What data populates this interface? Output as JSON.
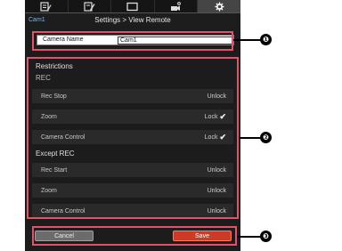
{
  "tabs": [
    {
      "icon": "edit-list-icon",
      "active": false
    },
    {
      "icon": "edit-pencil-icon",
      "active": false
    },
    {
      "icon": "view-screen-icon",
      "active": false
    },
    {
      "icon": "camera-settings-icon",
      "active": false
    },
    {
      "icon": "gear-icon",
      "active": true
    }
  ],
  "header": {
    "camera_label": "Cam1",
    "title": "Settings > View Remote"
  },
  "camera_name": {
    "label": "Camera Name",
    "value": "Cam1"
  },
  "restrictions": {
    "title": "Restrictions",
    "rec_title": "REC",
    "rec_rows": [
      {
        "label": "Rec Stop",
        "value": "Unlock",
        "checked": false
      },
      {
        "label": "Zoom",
        "value": "Lock",
        "checked": true
      },
      {
        "label": "Camera Control",
        "value": "Lock",
        "checked": true
      }
    ],
    "except_title": "Except REC",
    "except_rows": [
      {
        "label": "Rec Start",
        "value": "Unlock",
        "checked": false
      },
      {
        "label": "Zoom",
        "value": "Unlock",
        "checked": false
      },
      {
        "label": "Camera Control",
        "value": "Unlock",
        "checked": false
      }
    ]
  },
  "buttons": {
    "cancel": "Cancel",
    "save": "Save"
  },
  "callouts": [
    "❶",
    "❷",
    "❸"
  ],
  "colors": {
    "frame": "#e0546a",
    "save_button": "#cc3b26",
    "panel_bg": "#1c1c1c",
    "row_bg": "#2a2a2a",
    "camera_label": "#6fb7ff"
  }
}
